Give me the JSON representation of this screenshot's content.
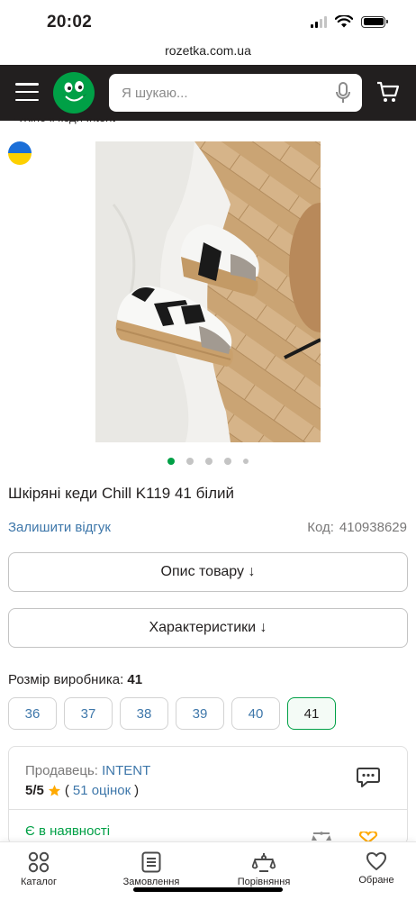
{
  "status_bar": {
    "time": "20:02"
  },
  "browser": {
    "url": "rozetka.com.ua"
  },
  "header": {
    "search_placeholder": "Я шукаю...",
    "colors": {
      "background": "#221f1f",
      "logo": "#00a046"
    }
  },
  "breadcrumb": {
    "label": "‹ Жіночі кеди Intent"
  },
  "gallery": {
    "image_count": 5,
    "active_index": 0
  },
  "product": {
    "title": "Шкіряні кеди Chill K119 41 білий",
    "review_link": "Залишити відгук",
    "code_label": "Код:",
    "code_value": "410938629"
  },
  "actions": {
    "description_button": "Опис товару ↓",
    "characteristics_button": "Характеристики ↓"
  },
  "sizes": {
    "label": "Розмір виробника:",
    "selected": "41",
    "options": [
      "36",
      "37",
      "38",
      "39",
      "40",
      "41"
    ]
  },
  "seller": {
    "label": "Продавець:",
    "name": "INTENT",
    "rating": "5/5",
    "reviews_open": "(",
    "reviews_link": "51 оцінок",
    "reviews_close": ")",
    "availability": "Є в наявності"
  },
  "bottom_nav": {
    "items": [
      {
        "label": "Каталог",
        "icon": "grid-icon"
      },
      {
        "label": "Замовлення",
        "icon": "orders-list-icon"
      },
      {
        "label": "Порівняння",
        "icon": "scales-icon"
      },
      {
        "label": "Обране",
        "icon": "heart-icon"
      }
    ]
  },
  "colors": {
    "accent": "#00a046",
    "link": "#3e77aa",
    "text": "#221f1f",
    "star": "#ffa900"
  }
}
